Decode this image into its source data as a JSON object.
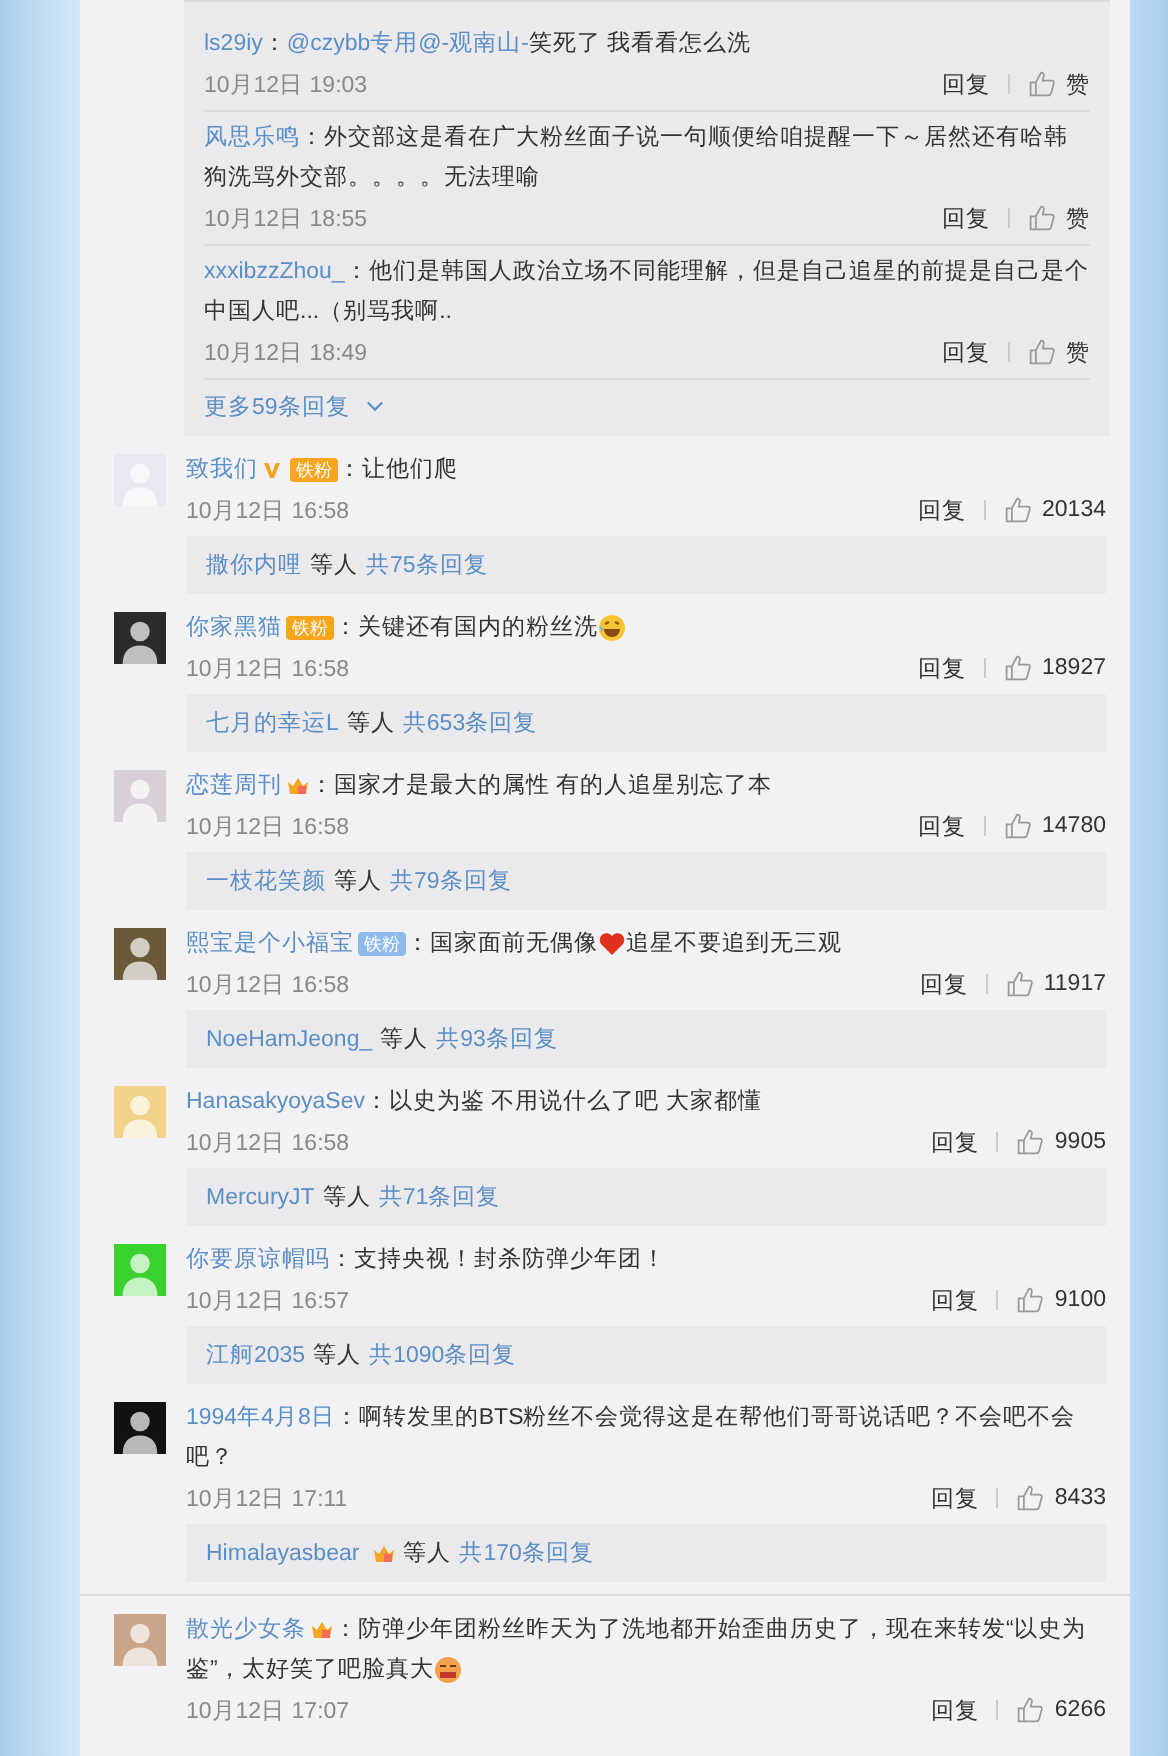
{
  "sub_replies": [
    {
      "user": "ls29iy",
      "text": [
        {
          "kind": "text",
          "value": "："
        },
        {
          "kind": "link",
          "value": "@czybb专用"
        },
        {
          "kind": "link",
          "value": "@-观南山-"
        },
        {
          "kind": "text",
          "value": "笑死了 我看看怎么洗"
        }
      ],
      "time": "10月12日 19:03",
      "reply": "回复",
      "like": "赞"
    },
    {
      "user": "风思乐鸣",
      "text": [
        {
          "kind": "text",
          "value": "：外交部这是看在广大粉丝面子说一句顺便给咱提醒一下～居然还有哈韩狗洗骂外交部。。。。无法理喻"
        }
      ],
      "time": "10月12日 18:55",
      "reply": "回复",
      "like": "赞"
    },
    {
      "user": "xxxibzzZhou_",
      "text": [
        {
          "kind": "text",
          "value": "：他们是韩国人政治立场不同能理解，但是自己追星的前提是自己是个中国人吧...（别骂我啊.."
        }
      ],
      "time": "10月12日 18:49",
      "reply": "回复",
      "like": "赞"
    }
  ],
  "more_replies": "更多59条回复",
  "comments": [
    {
      "user": "致我们",
      "badges": [
        {
          "kind": "v"
        },
        {
          "kind": "fan",
          "label": "铁粉"
        }
      ],
      "text": [
        {
          "kind": "text",
          "value": "：让他们爬"
        }
      ],
      "time": "10月12日 16:58",
      "reply": "回复",
      "likes": "20134",
      "summary": {
        "names": [
          {
            "name": "撒你内哩"
          }
        ],
        "others": "等人",
        "total": "共75条回复"
      }
    },
    {
      "user": "你家黑猫",
      "badges": [
        {
          "kind": "fan",
          "label": "铁粉"
        }
      ],
      "text": [
        {
          "kind": "text",
          "value": "：关键还有国内的粉丝洗"
        },
        {
          "kind": "emoji-laugh"
        }
      ],
      "time": "10月12日 16:58",
      "reply": "回复",
      "likes": "18927",
      "summary": {
        "names": [
          {
            "name": "七月的幸运L"
          }
        ],
        "others": "等人",
        "total": "共653条回复"
      }
    },
    {
      "user": "恋莲周刊",
      "badges": [
        {
          "kind": "crown"
        }
      ],
      "text": [
        {
          "kind": "text",
          "value": "：国家才是最大的属性 有的人追星别忘了本"
        }
      ],
      "time": "10月12日 16:58",
      "reply": "回复",
      "likes": "14780",
      "summary": {
        "names": [
          {
            "name": "一枝花笑颜"
          }
        ],
        "others": "等人",
        "total": "共79条回复"
      }
    },
    {
      "user": "熙宝是个小福宝",
      "badges": [
        {
          "kind": "fan-plain",
          "label": "铁粉"
        }
      ],
      "text": [
        {
          "kind": "text",
          "value": "：国家面前无偶像"
        },
        {
          "kind": "emoji-heart"
        },
        {
          "kind": "text",
          "value": "追星不要追到无三观"
        }
      ],
      "time": "10月12日 16:58",
      "reply": "回复",
      "likes": "11917",
      "summary": {
        "names": [
          {
            "name": "NoeHamJeong_"
          }
        ],
        "others": "等人",
        "total": "共93条回复"
      }
    },
    {
      "user": "HanasakyoyaSev",
      "text": [
        {
          "kind": "text",
          "value": "：以史为鉴 不用说什么了吧 大家都懂"
        }
      ],
      "time": "10月12日 16:58",
      "reply": "回复",
      "likes": "9905",
      "summary": {
        "names": [
          {
            "name": "MercuryJT"
          }
        ],
        "others": "等人",
        "total": "共71条回复"
      }
    },
    {
      "user": "你要原谅帽吗",
      "text": [
        {
          "kind": "text",
          "value": "：支持央视！封杀防弹少年团！"
        }
      ],
      "time": "10月12日 16:57",
      "reply": "回复",
      "likes": "9100",
      "summary": {
        "names": [
          {
            "name": "江舸2035"
          }
        ],
        "others": "等人",
        "total": "共1090条回复"
      }
    },
    {
      "user": "1994年4月8日",
      "text": [
        {
          "kind": "text",
          "value": "：啊转发里的BTS粉丝不会觉得这是在帮他们哥哥说话吧？不会吧不会吧？"
        }
      ],
      "time": "10月12日 17:11",
      "reply": "回复",
      "likes": "8433",
      "summary": {
        "names": [
          {
            "name": "Himalayasbear",
            "badges": [
              {
                "kind": "crown"
              }
            ]
          }
        ],
        "others": "等人",
        "total": "共170条回复"
      }
    },
    {
      "user": "散光少女条",
      "badges": [
        {
          "kind": "crown"
        }
      ],
      "text": [
        {
          "kind": "text",
          "value": "：防弹少年团粉丝昨天为了洗地都开始歪曲历史了，现在来转发“以史为鉴”，太好笑了吧脸真大"
        },
        {
          "kind": "emoji-cry"
        }
      ],
      "time": "10月12日 17:07",
      "reply": "回复",
      "likes": "6266"
    }
  ]
}
